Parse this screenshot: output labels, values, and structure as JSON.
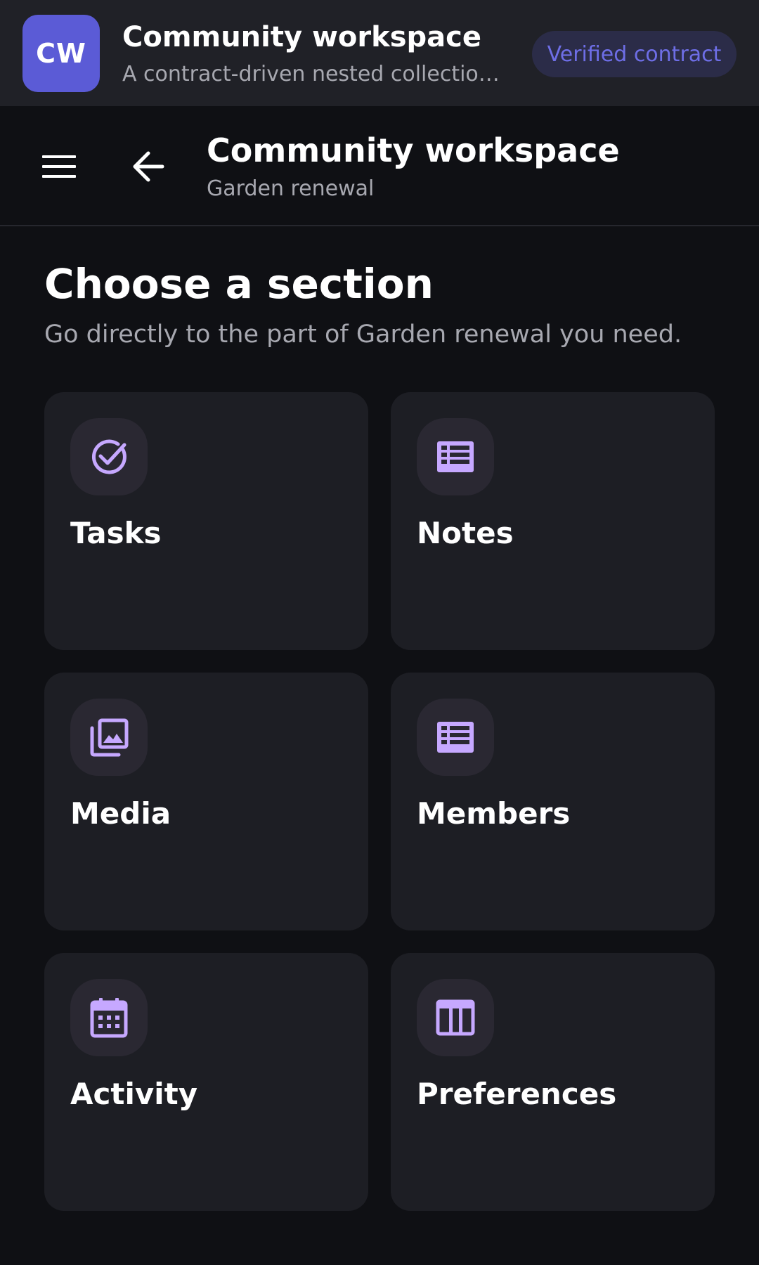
{
  "app_header": {
    "logo_text": "CW",
    "title": "Community workspace",
    "subtitle": "A contract-driven nested collection workspace",
    "badge": "Verified contract"
  },
  "nav": {
    "title": "Community workspace",
    "subtitle": "Garden renewal",
    "menu_icon": "hamburger-menu-icon",
    "back_icon": "arrow-left-icon"
  },
  "main": {
    "heading": "Choose a section",
    "description": "Go directly to the part of Garden renewal you need.",
    "sections": [
      {
        "label": "Tasks",
        "icon": "check-circle-icon"
      },
      {
        "label": "Notes",
        "icon": "list-icon"
      },
      {
        "label": "Media",
        "icon": "photo-library-icon"
      },
      {
        "label": "Members",
        "icon": "list-icon"
      },
      {
        "label": "Activity",
        "icon": "calendar-icon"
      },
      {
        "label": "Preferences",
        "icon": "table-layout-icon"
      }
    ]
  },
  "colors": {
    "accent": "#5b5bd6",
    "icon_tint": "#c6a8ff",
    "background": "#0f1014",
    "card": "#1d1e24"
  }
}
